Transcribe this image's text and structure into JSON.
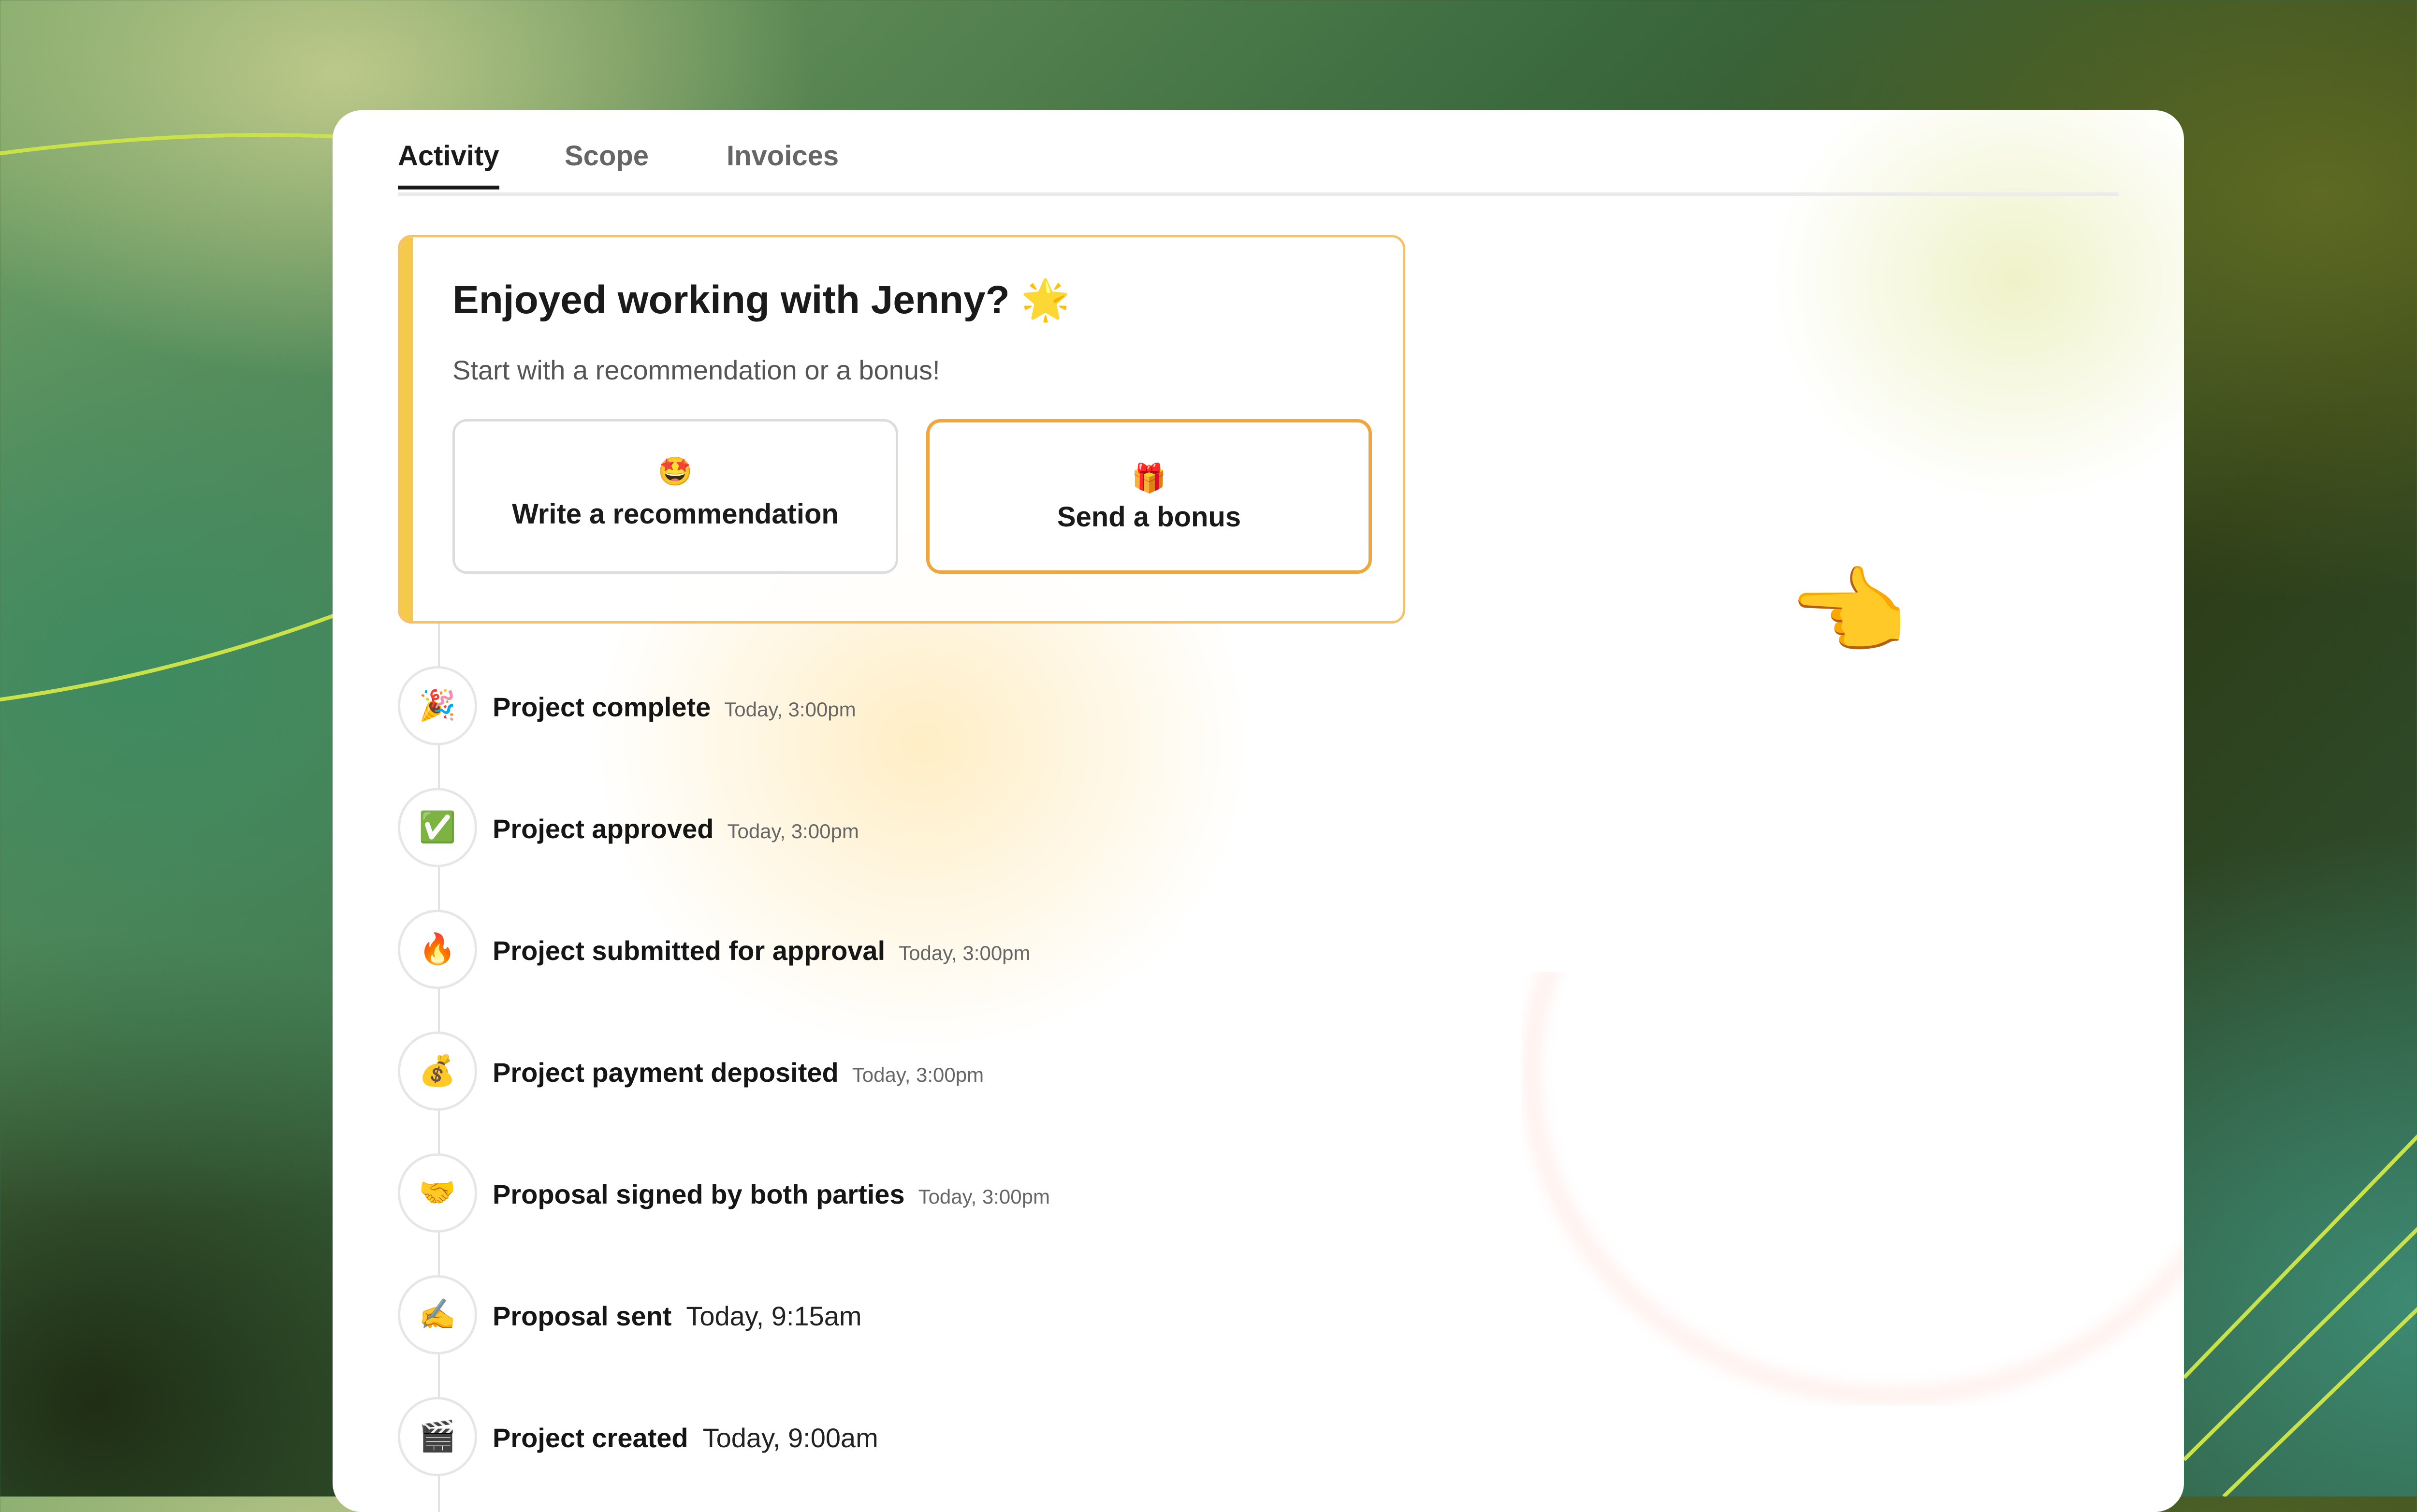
{
  "tabs": [
    {
      "label": "Activity",
      "active": true
    },
    {
      "label": "Scope",
      "active": false
    },
    {
      "label": "Invoices",
      "active": false
    }
  ],
  "recommendation": {
    "title": "Enjoyed working with Jenny?",
    "title_emoji": "🌟",
    "subtitle": "Start with a recommendation or a bonus!",
    "write_button": {
      "emoji": "🤩",
      "label": "Write a recommendation"
    },
    "bonus_button": {
      "emoji": "🎁",
      "label": "Send a bonus"
    },
    "pointer_emoji": "👈"
  },
  "timeline": [
    {
      "icon": "🎉",
      "icon_name": "party-popper-icon",
      "title": "Project complete",
      "time": "Today, 3:00pm"
    },
    {
      "icon": "✅",
      "icon_name": "check-mark-icon",
      "title": "Project approved",
      "time": "Today, 3:00pm"
    },
    {
      "icon": "🔥",
      "icon_name": "fire-icon",
      "title": "Project submitted for approval",
      "time": "Today, 3:00pm"
    },
    {
      "icon": "💰",
      "icon_name": "money-bag-icon",
      "title": "Project payment deposited",
      "time": "Today, 3:00pm"
    },
    {
      "icon": "🤝",
      "icon_name": "handshake-icon",
      "title": "Proposal signed by both parties",
      "time": "Today, 3:00pm"
    },
    {
      "icon": "✍️",
      "icon_name": "writing-hand-icon",
      "title": "Proposal sent",
      "time": "Today, 9:15am"
    },
    {
      "icon": "🎬",
      "icon_name": "clapper-board-icon",
      "title": "Project created",
      "time": "Today, 9:00am"
    }
  ],
  "colors": {
    "accent": "#f5c94c",
    "bonus_border": "#f0a63a",
    "text": "#1a1a1a"
  }
}
